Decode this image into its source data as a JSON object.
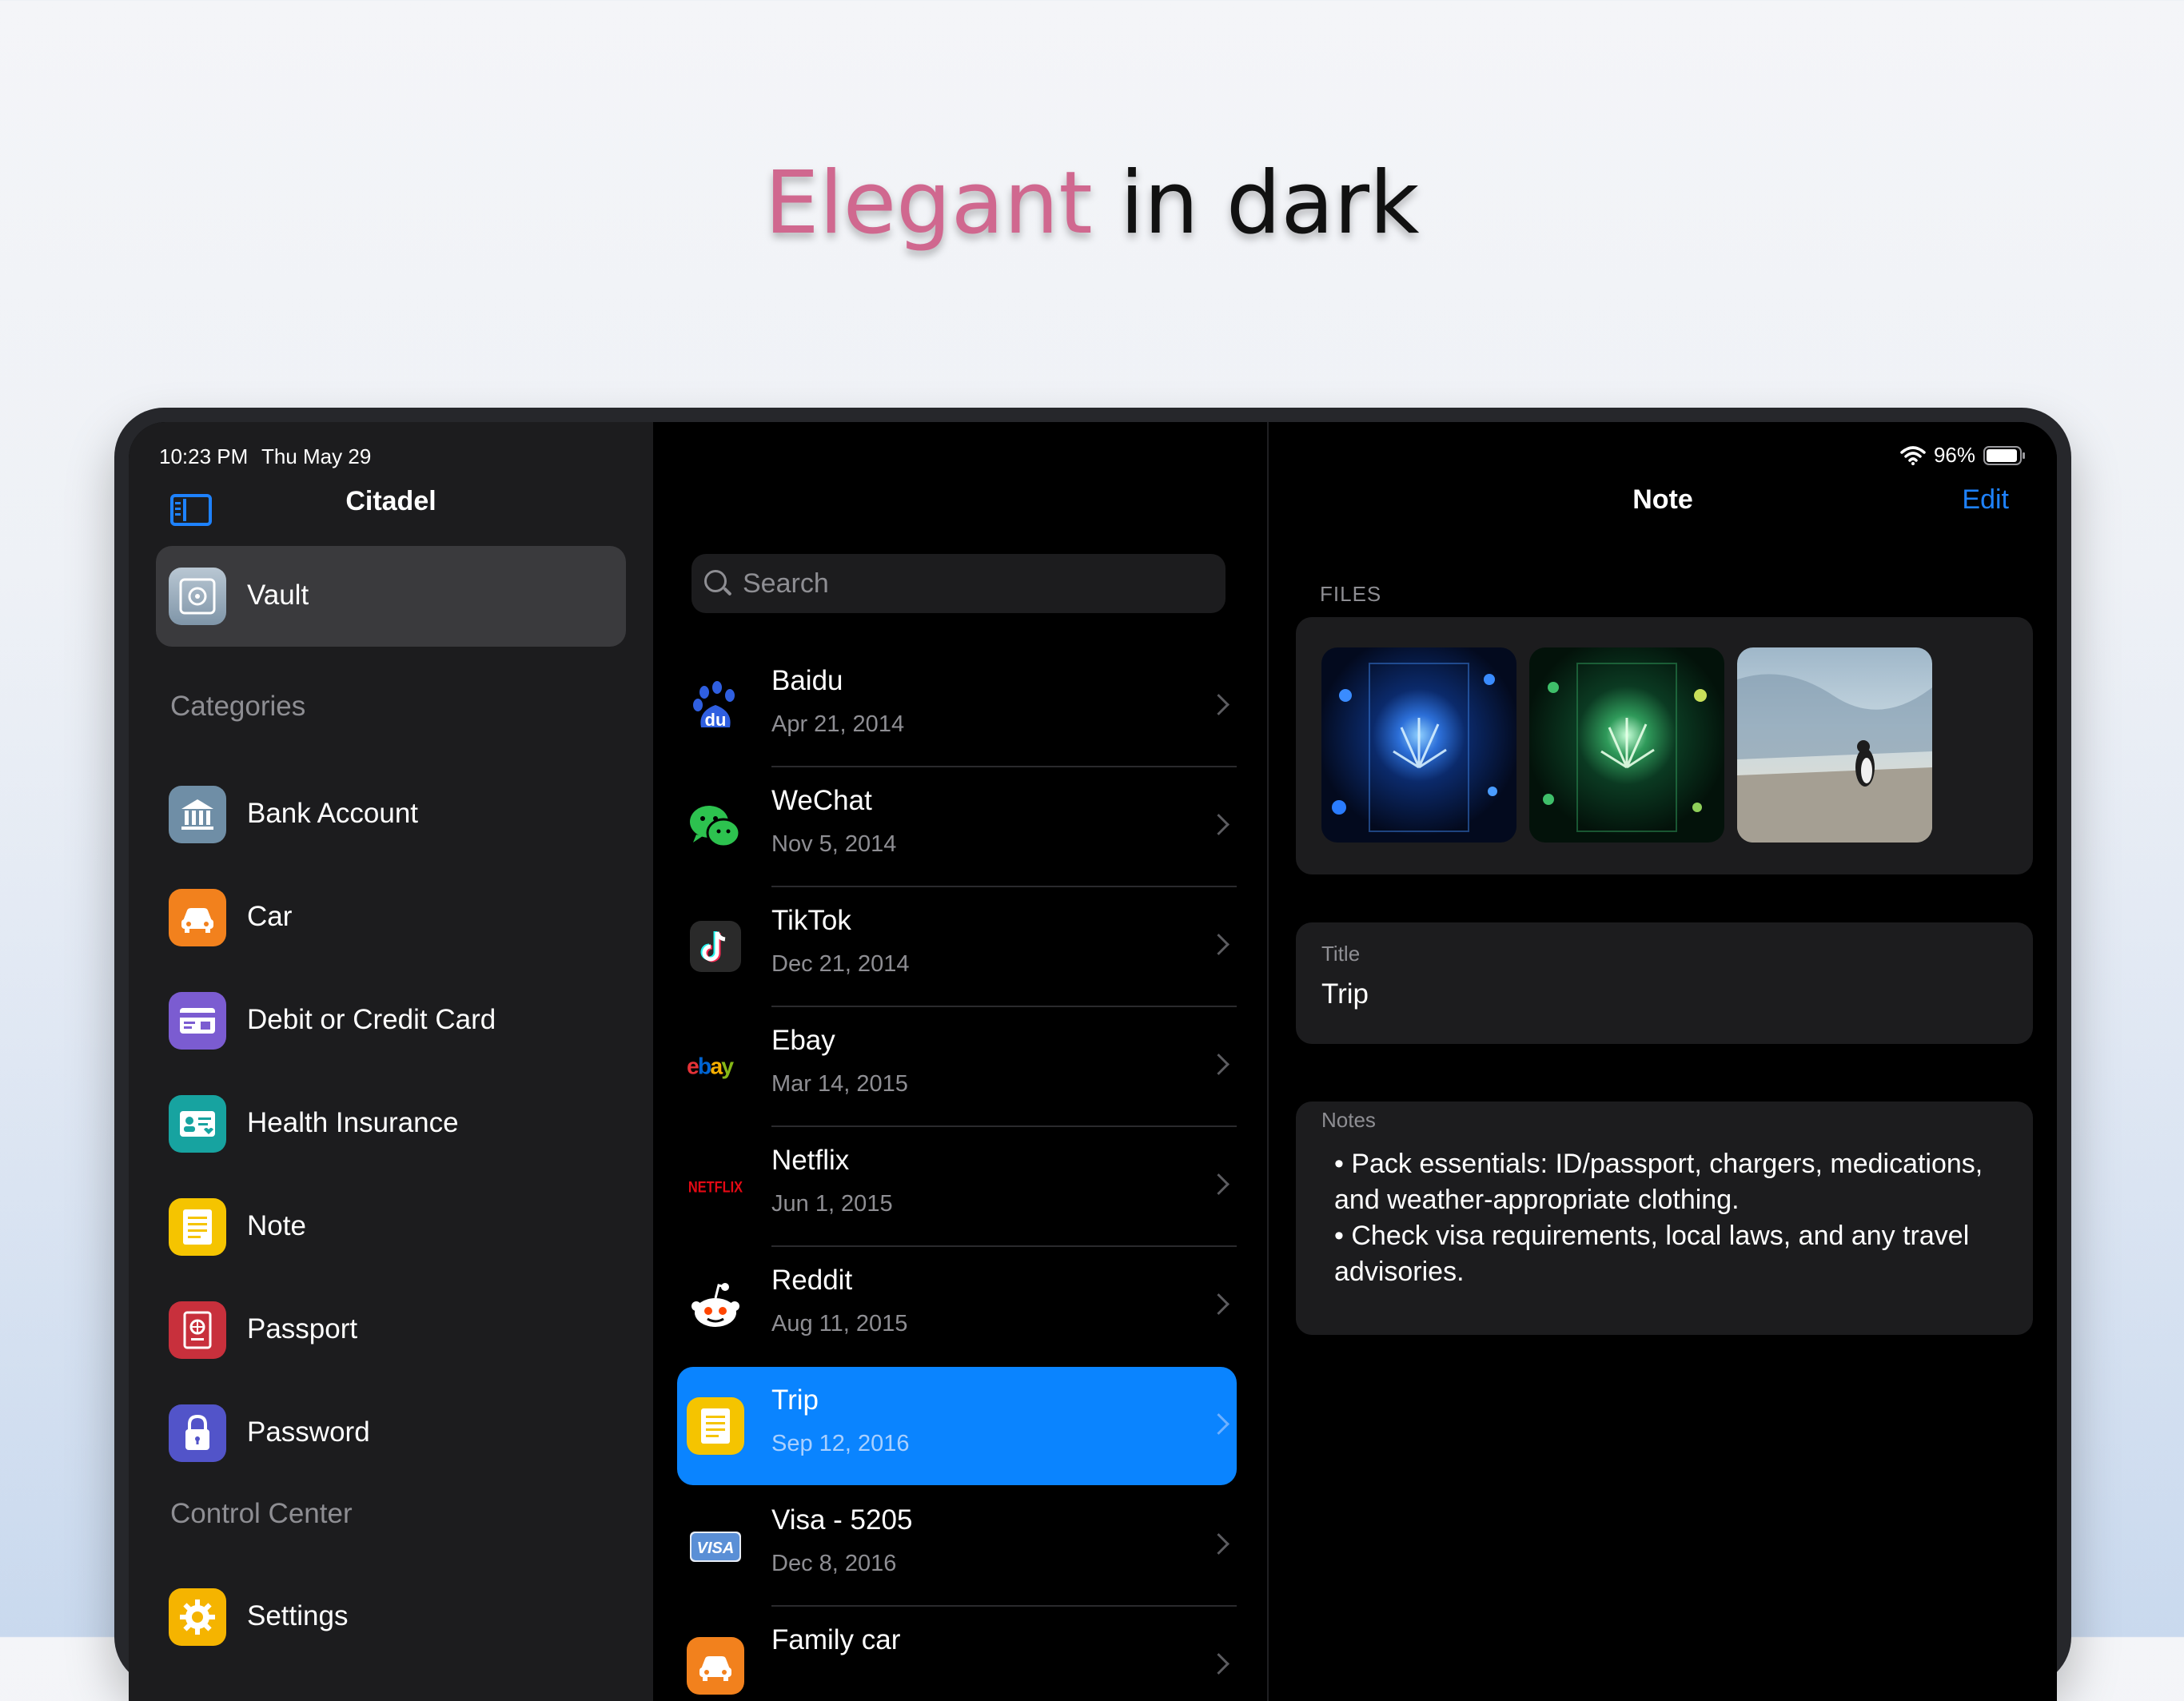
{
  "headline": {
    "accent": "Elegant",
    "rest": " in dark"
  },
  "status_bar": {
    "time": "10:23 PM",
    "date": "Thu May 29",
    "battery": "96%"
  },
  "sidebar": {
    "title": "Citadel",
    "vault_label": "Vault",
    "categories_header": "Categories",
    "categories": [
      {
        "label": "Bank Account",
        "icon": "bank-icon",
        "color": "#6f8ea6"
      },
      {
        "label": "Car",
        "icon": "car-icon",
        "color": "#f2811d"
      },
      {
        "label": "Debit or Credit Card",
        "icon": "credit-card-icon",
        "color": "#7b5cd1"
      },
      {
        "label": "Health Insurance",
        "icon": "health-card-icon",
        "color": "#17a3a0"
      },
      {
        "label": "Note",
        "icon": "note-icon",
        "color": "#f5c400"
      },
      {
        "label": "Passport",
        "icon": "passport-icon",
        "color": "#c8303c"
      },
      {
        "label": "Password",
        "icon": "lock-icon",
        "color": "#5254c9"
      }
    ],
    "control_center_header": "Control Center",
    "control_items": [
      {
        "label": "Settings",
        "icon": "settings-gear-icon",
        "color": "#f5b400"
      }
    ]
  },
  "list": {
    "search_placeholder": "Search",
    "items": [
      {
        "title": "Baidu",
        "date": "Apr 21, 2014",
        "icon": "baidu-icon"
      },
      {
        "title": "WeChat",
        "date": "Nov 5, 2014",
        "icon": "wechat-icon"
      },
      {
        "title": "TikTok",
        "date": "Dec 21, 2014",
        "icon": "tiktok-icon"
      },
      {
        "title": "Ebay",
        "date": "Mar 14, 2015",
        "icon": "ebay-icon"
      },
      {
        "title": "Netflix",
        "date": "Jun 1, 2015",
        "icon": "netflix-icon"
      },
      {
        "title": "Reddit",
        "date": "Aug 11, 2015",
        "icon": "reddit-icon"
      },
      {
        "title": "Trip",
        "date": "Sep 12, 2016",
        "icon": "note-icon",
        "selected": true
      },
      {
        "title": "Visa - 5205",
        "date": "Dec 8, 2016",
        "icon": "visa-icon"
      },
      {
        "title": "Family car",
        "date": "",
        "icon": "car-icon"
      }
    ],
    "icon_text": {
      "baidu": "du",
      "ebay": [
        "e",
        "b",
        "a",
        "y"
      ],
      "netflix": "NETFLIX",
      "visa": "VISA"
    }
  },
  "detail": {
    "nav_title": "Note",
    "edit_label": "Edit",
    "files_label": "FILES",
    "title_label": "Title",
    "title_value": "Trip",
    "notes_label": "Notes",
    "notes_lines": [
      "• Pack essentials: ID/passport, chargers, medications, and weather-appropriate clothing.",
      "• Check visa requirements, local laws, and any travel advisories."
    ]
  },
  "colors": {
    "accent": "#0a84ff",
    "headline_accent": "#d0688f"
  }
}
